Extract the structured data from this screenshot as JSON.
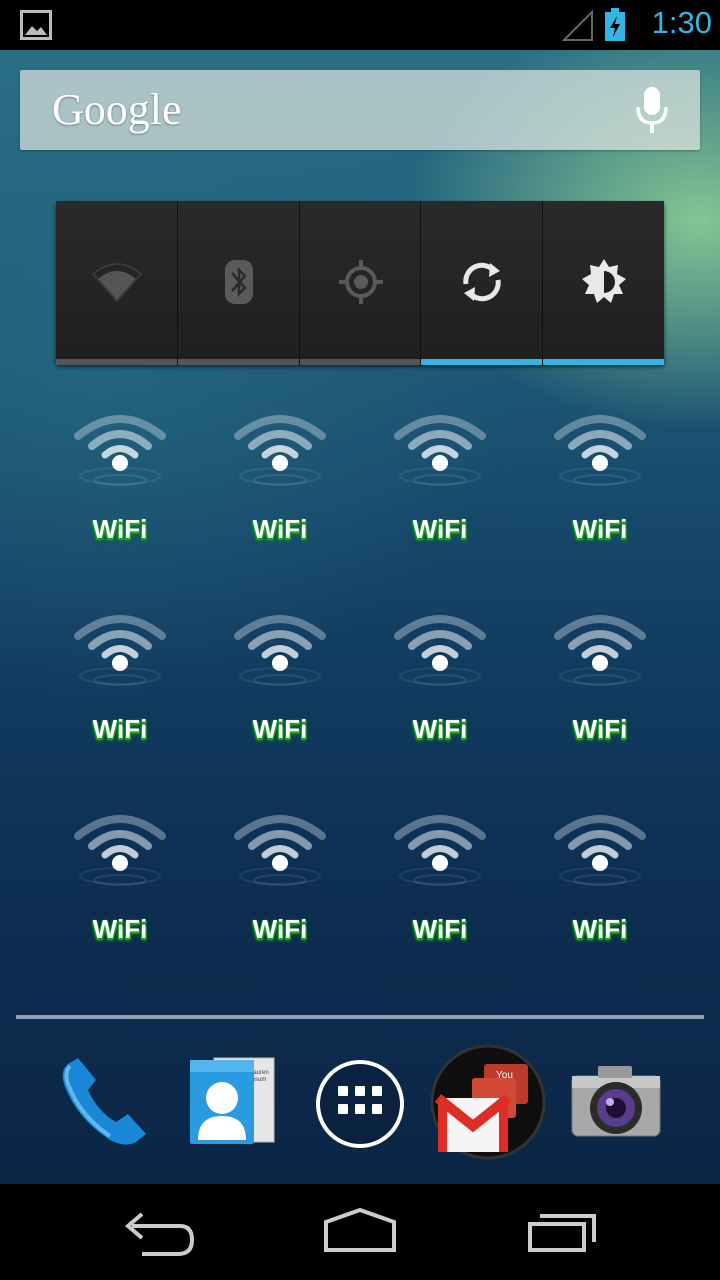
{
  "status_bar": {
    "time": "1:30",
    "icons": [
      "image-notification-icon",
      "signal-icon",
      "battery-charging-icon"
    ],
    "accent_color": "#33b5e5"
  },
  "search_bar": {
    "logo_text": "Google",
    "mic_icon": "microphone-icon"
  },
  "power_control": {
    "buttons": [
      {
        "name": "wifi",
        "icon": "wifi-icon",
        "state": "off"
      },
      {
        "name": "bluetooth",
        "icon": "bluetooth-icon",
        "state": "off"
      },
      {
        "name": "gps",
        "icon": "gps-icon",
        "state": "off"
      },
      {
        "name": "sync",
        "icon": "sync-icon",
        "state": "on"
      },
      {
        "name": "brightness",
        "icon": "brightness-icon",
        "state": "on"
      }
    ]
  },
  "widgets": [
    {
      "label": "WiFi"
    },
    {
      "label": "WiFi"
    },
    {
      "label": "WiFi"
    },
    {
      "label": "WiFi"
    },
    {
      "label": "WiFi"
    },
    {
      "label": "WiFi"
    },
    {
      "label": "WiFi"
    },
    {
      "label": "WiFi"
    },
    {
      "label": "WiFi"
    },
    {
      "label": "WiFi"
    },
    {
      "label": "WiFi"
    },
    {
      "label": "WiFi"
    }
  ],
  "dock": {
    "apps": [
      {
        "name": "Phone",
        "icon": "phone-icon"
      },
      {
        "name": "People",
        "icon": "contacts-icon",
        "card_text": "Lauren Ipsum"
      },
      {
        "name": "All apps",
        "icon": "app-drawer-icon"
      },
      {
        "name": "Gmail folder",
        "icon": "gmail-icon"
      },
      {
        "name": "Camera",
        "icon": "camera-icon"
      }
    ]
  },
  "nav_bar": {
    "buttons": [
      "back-icon",
      "home-icon",
      "recent-apps-icon"
    ]
  }
}
